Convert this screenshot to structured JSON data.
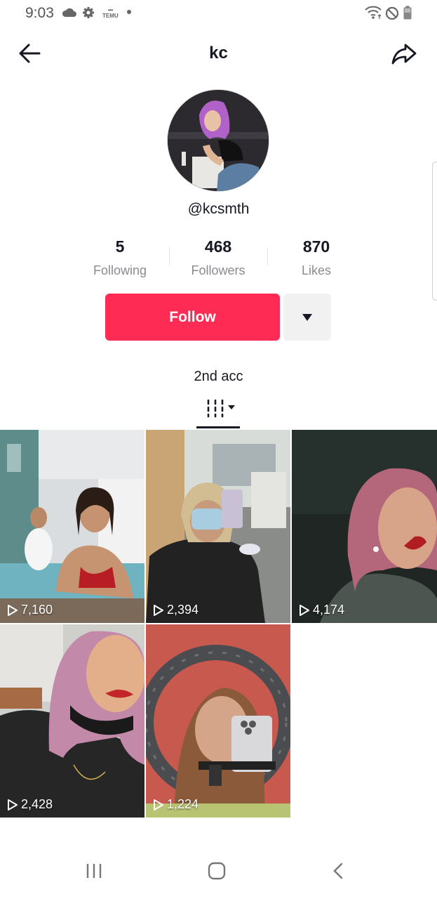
{
  "status_bar": {
    "time": "9:03",
    "temu_label": "TEMU"
  },
  "header": {
    "title": "kc"
  },
  "profile": {
    "username": "@kcsmth",
    "stats": [
      {
        "value": "5",
        "label": "Following"
      },
      {
        "value": "468",
        "label": "Followers"
      },
      {
        "value": "870",
        "label": "Likes"
      }
    ],
    "follow_label": "Follow",
    "bio": "2nd acc"
  },
  "videos": [
    {
      "views": "7,160"
    },
    {
      "views": "2,394"
    },
    {
      "views": "4,174"
    },
    {
      "views": "2,428"
    },
    {
      "views": "1,224"
    }
  ],
  "colors": {
    "accent": "#fe2c55",
    "text": "#161823",
    "muted": "#8a8b91"
  }
}
